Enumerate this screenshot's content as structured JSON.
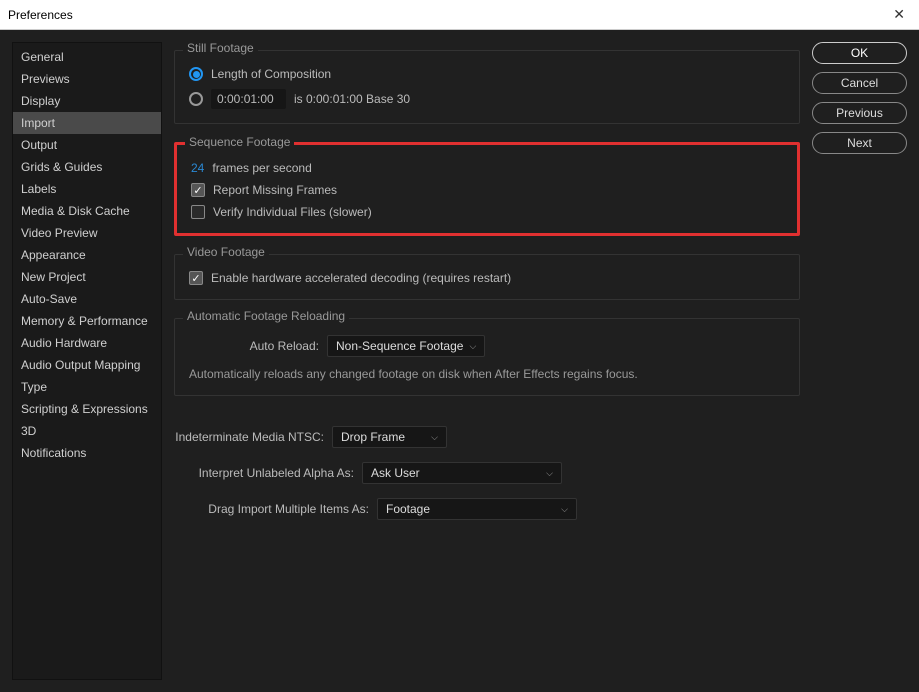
{
  "titlebar": {
    "title": "Preferences"
  },
  "sidebar": {
    "items": [
      "General",
      "Previews",
      "Display",
      "Import",
      "Output",
      "Grids & Guides",
      "Labels",
      "Media & Disk Cache",
      "Video Preview",
      "Appearance",
      "New Project",
      "Auto-Save",
      "Memory & Performance",
      "Audio Hardware",
      "Audio Output Mapping",
      "Type",
      "Scripting & Expressions",
      "3D",
      "Notifications"
    ],
    "active_index": 3
  },
  "still_footage": {
    "legend": "Still Footage",
    "opt1_label": "Length of Composition",
    "opt2_value": "0:00:01:00",
    "opt2_suffix_label": "is 0:00:01:00    Base 30",
    "selected": 0
  },
  "sequence_footage": {
    "legend": "Sequence Footage",
    "fps_value": "24",
    "fps_suffix": "frames per second",
    "report_label": "Report Missing Frames",
    "report_checked": true,
    "verify_label": "Verify Individual Files (slower)",
    "verify_checked": false
  },
  "video_footage": {
    "legend": "Video Footage",
    "hw_label": "Enable hardware accelerated decoding (requires restart)",
    "hw_checked": true
  },
  "auto_reloading": {
    "legend": "Automatic Footage Reloading",
    "auto_reload_label": "Auto Reload:",
    "auto_reload_value": "Non-Sequence Footage",
    "note": "Automatically reloads any changed footage on disk when After Effects regains focus."
  },
  "dropdowns": {
    "ntsc_label": "Indeterminate Media NTSC:",
    "ntsc_value": "Drop Frame",
    "alpha_label": "Interpret Unlabeled Alpha As:",
    "alpha_value": "Ask User",
    "drag_label": "Drag Import Multiple Items As:",
    "drag_value": "Footage"
  },
  "buttons": {
    "ok": "OK",
    "cancel": "Cancel",
    "previous": "Previous",
    "next": "Next"
  }
}
